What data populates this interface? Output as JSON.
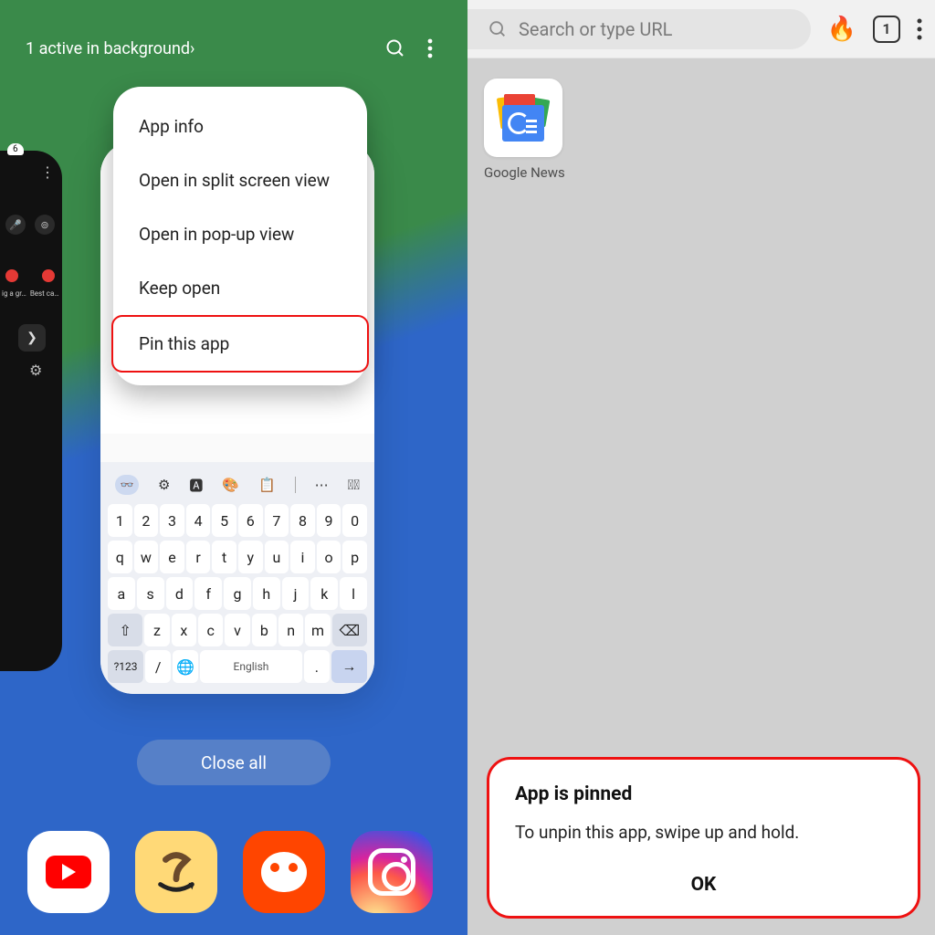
{
  "left": {
    "header": {
      "status_text": "1 active in background",
      "chevron": "›"
    },
    "prev_card": {
      "badge": "6",
      "tiny_a": "ig a gr…",
      "tiny_b": "Best ca…"
    },
    "context_menu": {
      "items": [
        {
          "label": "App info"
        },
        {
          "label": "Open in split screen view"
        },
        {
          "label": "Open in pop-up view"
        },
        {
          "label": "Keep open"
        },
        {
          "label": "Pin this app",
          "highlight": true
        }
      ]
    },
    "keyboard": {
      "space_label": "English",
      "sym_label": "?123",
      "row1": [
        "1",
        "2",
        "3",
        "4",
        "5",
        "6",
        "7",
        "8",
        "9",
        "0"
      ],
      "row2": [
        "q",
        "w",
        "e",
        "r",
        "t",
        "y",
        "u",
        "i",
        "o",
        "p"
      ],
      "row3": [
        "a",
        "s",
        "d",
        "f",
        "g",
        "h",
        "j",
        "k",
        "l"
      ],
      "row4_letters": [
        "z",
        "x",
        "c",
        "v",
        "b",
        "n",
        "m"
      ]
    },
    "close_all_label": "Close all",
    "dock": [
      "YouTube",
      "Amazon",
      "Reddit",
      "Instagram"
    ]
  },
  "right": {
    "url_placeholder": "Search or type URL",
    "tab_count": "1",
    "bookmark_label": "Google News",
    "dialog": {
      "title": "App is pinned",
      "body": "To unpin this app, swipe up and hold.",
      "ok": "OK"
    }
  }
}
